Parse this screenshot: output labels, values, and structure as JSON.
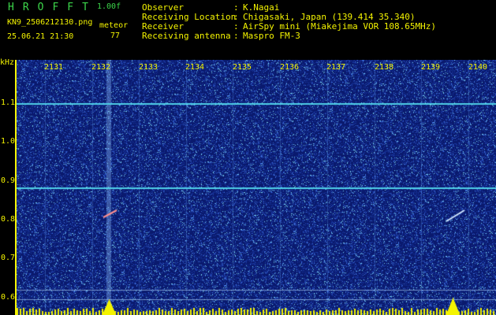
{
  "header": {
    "logo": "HROFFT",
    "version": "1.00f",
    "filename": "KN9_2506212130.png",
    "meteor_label": "meteor",
    "meteor_count": "77",
    "datetime": "25.06.21 21:30",
    "info": [
      {
        "label": "Observer",
        "value": "K.Nagai"
      },
      {
        "label": "Receiving Location",
        "value": "Chigasaki, Japan (139.414 35.340)"
      },
      {
        "label": "Receiver",
        "value": "AirSpy mini (Miakejima VOR 108.65MHz)"
      },
      {
        "label": "Receiving antenna",
        "value": "Maspro FM-3"
      }
    ]
  },
  "axis": {
    "unit": "kHz",
    "y_ticks": [
      "1.1",
      "1.0",
      "0.9",
      "0.8",
      "0.7",
      "0.6"
    ],
    "x_ticks": [
      "2131",
      "2132",
      "2133",
      "2134",
      "2135",
      "2136",
      "2137",
      "2138",
      "2139",
      "2140"
    ]
  },
  "colors": {
    "background": "#000000",
    "spectrum_base": "#0a1a6e",
    "noise": "#3a6ad8",
    "carrier": "#4fd0e8",
    "axis_text": "#f4f400",
    "title_text": "#3cd64a"
  }
}
